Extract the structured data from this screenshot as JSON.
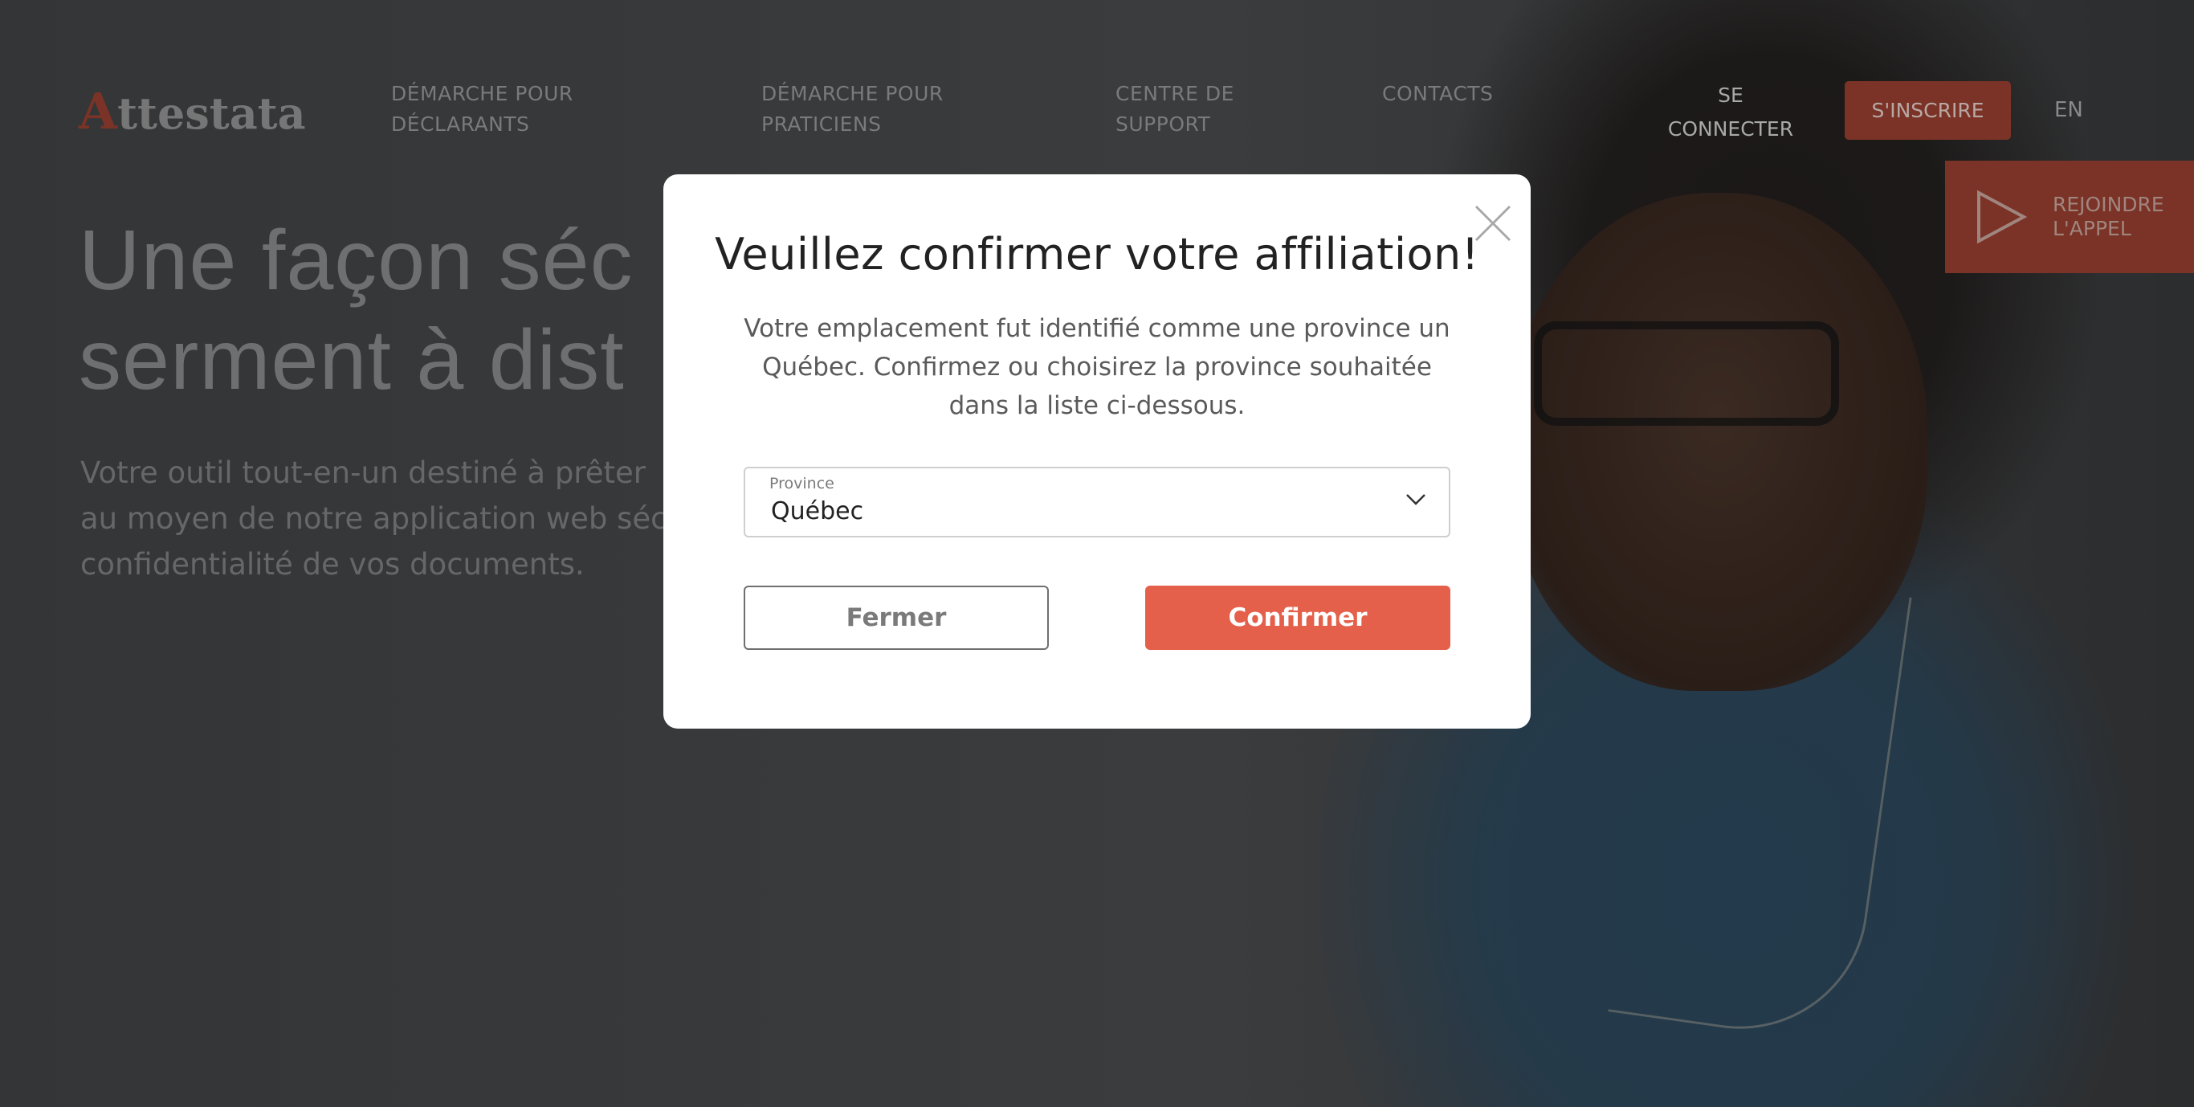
{
  "header": {
    "logo_initial": "A",
    "logo_rest": "ttestata",
    "nav": [
      {
        "line1": "DÉMARCHE POUR",
        "line2": "DÉCLARANTS"
      },
      {
        "line1": "DÉMARCHE POUR",
        "line2": "PRATICIENS"
      },
      {
        "line1": "CENTRE DE",
        "line2": "SUPPORT"
      },
      {
        "line1": "CONTACTS",
        "line2": ""
      }
    ],
    "login_line1": "SE",
    "login_line2": "CONNECTER",
    "signup_label": "S'INSCRIRE",
    "language": "EN"
  },
  "call_banner": {
    "line1": "REJOINDRE",
    "line2": "L'APPEL",
    "icon": "play-icon"
  },
  "hero": {
    "title_line1": "Une façon séc",
    "title_line2": "serment à dist",
    "subtitle_line1": "Votre outil tout-en-un destiné à prêter",
    "subtitle_line2": "au moyen de notre application web séc",
    "subtitle_line3": "confidentialité de vos documents."
  },
  "modal": {
    "title": "Veuillez confirmer votre affiliation!",
    "description_line1": "Votre emplacement fut identifié comme une province un",
    "description_line2": "Québec. Confirmez ou choisirez la province souhaitée",
    "description_line3": "dans la liste ci-dessous.",
    "select_label": "Province",
    "select_value": "Québec",
    "close_button_label": "Fermer",
    "confirm_button_label": "Confirmer",
    "close_icon": "close-icon",
    "chevron_icon": "chevron-down-icon"
  },
  "colors": {
    "accent": "#e4604a",
    "accent_dimmed": "#7a3326",
    "overlay": "#2e2f31"
  }
}
